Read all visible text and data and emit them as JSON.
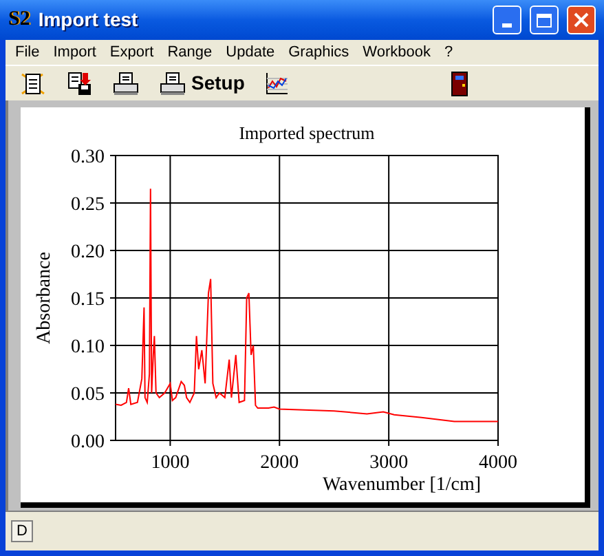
{
  "window": {
    "title": "Import test",
    "app_icon": "S2"
  },
  "menu": [
    "File",
    "Import",
    "Export",
    "Range",
    "Update",
    "Graphics",
    "Workbook",
    "?"
  ],
  "toolbar": {
    "setup_label": "Setup"
  },
  "chart_data": {
    "type": "line",
    "grid": true,
    "title": "Imported spectrum",
    "xlabel": "Wavenumber [1/cm]",
    "ylabel": "Absorbance",
    "xlim": [
      500,
      4000
    ],
    "ylim": [
      0,
      0.3
    ],
    "xticks": [
      1000,
      2000,
      3000,
      4000
    ],
    "yticks": [
      {
        "value": 0,
        "label": "0.00"
      },
      {
        "value": 0.05,
        "label": "0.05"
      },
      {
        "value": 0.1,
        "label": "0.10"
      },
      {
        "value": 0.15,
        "label": "0.15"
      },
      {
        "value": 0.2,
        "label": "0.20"
      },
      {
        "value": 0.25,
        "label": "0.25"
      },
      {
        "value": 0.3,
        "label": "0.30"
      }
    ],
    "x": [
      500,
      550,
      600,
      620,
      640,
      700,
      740,
      760,
      770,
      790,
      810,
      820,
      830,
      845,
      855,
      870,
      900,
      950,
      1000,
      1020,
      1050,
      1100,
      1130,
      1150,
      1180,
      1220,
      1240,
      1260,
      1290,
      1320,
      1350,
      1370,
      1390,
      1420,
      1450,
      1500,
      1540,
      1560,
      1600,
      1630,
      1680,
      1700,
      1720,
      1740,
      1760,
      1780,
      1800,
      1900,
      1950,
      2000,
      2500,
      2800,
      2950,
      3050,
      3300,
      3600,
      4000
    ],
    "series": [
      {
        "color": "#ff0000",
        "values": [
          0.038,
          0.037,
          0.04,
          0.055,
          0.038,
          0.04,
          0.065,
          0.14,
          0.045,
          0.04,
          0.07,
          0.265,
          0.05,
          0.09,
          0.11,
          0.05,
          0.045,
          0.05,
          0.06,
          0.042,
          0.045,
          0.062,
          0.058,
          0.045,
          0.04,
          0.05,
          0.11,
          0.075,
          0.095,
          0.06,
          0.155,
          0.17,
          0.06,
          0.045,
          0.05,
          0.045,
          0.085,
          0.045,
          0.09,
          0.04,
          0.042,
          0.15,
          0.155,
          0.09,
          0.1,
          0.037,
          0.034,
          0.034,
          0.035,
          0.033,
          0.031,
          0.028,
          0.03,
          0.027,
          0.024,
          0.02,
          0.02
        ]
      }
    ]
  },
  "status_bar": {
    "cell": "D"
  }
}
